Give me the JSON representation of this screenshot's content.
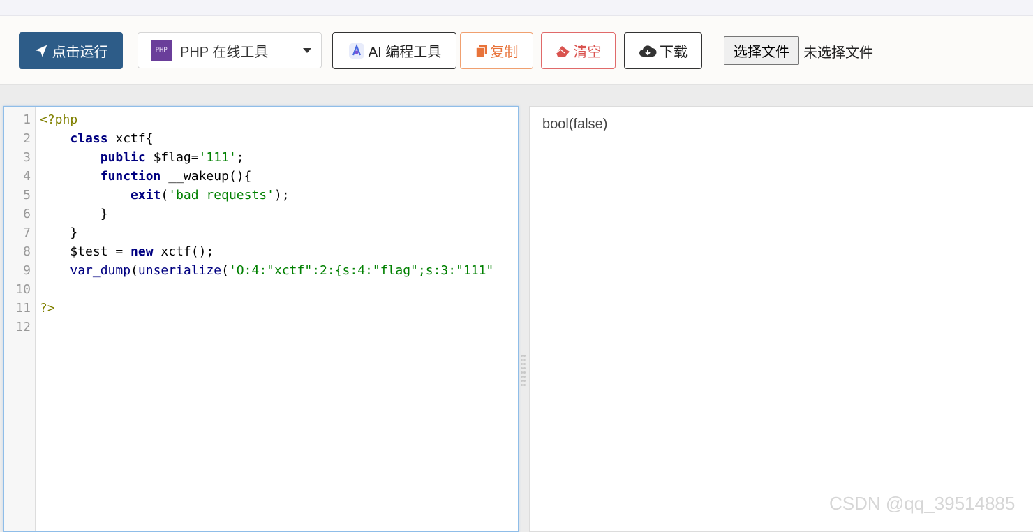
{
  "toolbar": {
    "run_label": "点击运行",
    "language_label": "PHP 在线工具",
    "php_logo_text": "PHP",
    "ai_label": "AI 编程工具",
    "copy_label": "复制",
    "clear_label": "清空",
    "download_label": "下载",
    "file_button_label": "选择文件",
    "file_status": "未选择文件"
  },
  "editor": {
    "line_numbers": [
      "1",
      "2",
      "3",
      "4",
      "5",
      "6",
      "7",
      "8",
      "9",
      "10",
      "11",
      "12"
    ]
  },
  "output": {
    "text": "bool(false)"
  },
  "watermark": "CSDN @qq_39514885",
  "colors": {
    "run_button": "#2d5c88",
    "copy_accent": "#e8733a",
    "clear_accent": "#d9534f",
    "keyword": "#000080",
    "string": "#008000",
    "php_tag": "#808000"
  }
}
